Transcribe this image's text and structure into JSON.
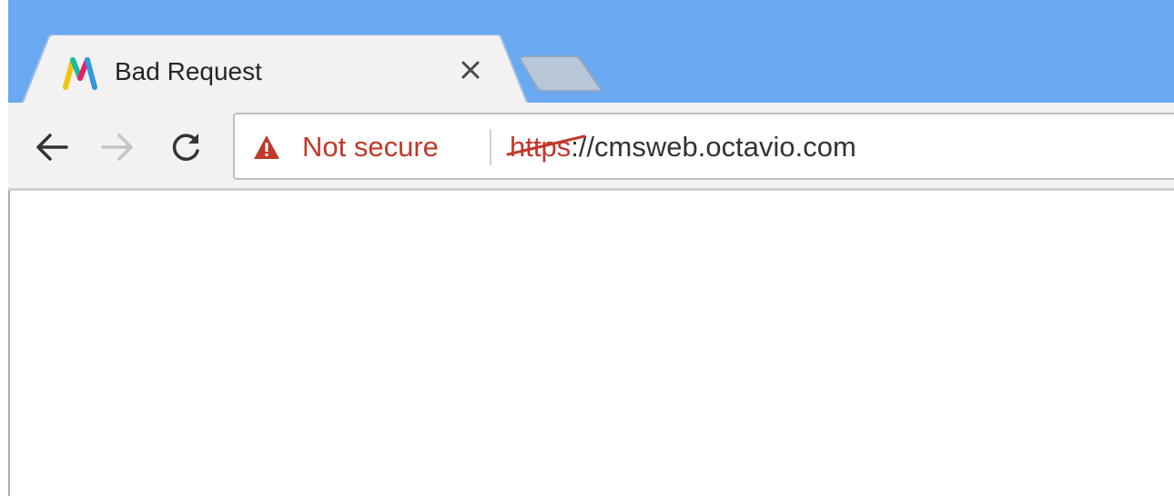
{
  "tab": {
    "title": "Bad Request",
    "close_glyph": "×",
    "favicon": "letter-m-favicon-icon"
  },
  "nav": {
    "back_icon": "arrow-left-icon",
    "forward_icon": "arrow-right-icon",
    "reload_icon": "reload-icon"
  },
  "omnibox": {
    "security_icon": "warning-triangle-icon",
    "security_text": "Not secure",
    "scheme": "https",
    "rest": "://cmsweb.octavio.com"
  },
  "colors": {
    "tabstrip": "#6aa9f2",
    "toolbar": "#f2f2f2",
    "warning": "#c0392b"
  }
}
